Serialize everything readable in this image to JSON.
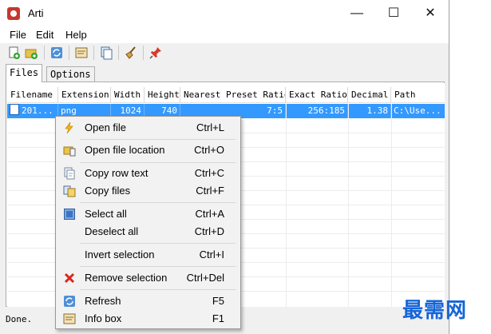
{
  "window": {
    "title": "Arti",
    "minimize_glyph": "—",
    "maximize_glyph": "☐",
    "close_glyph": "✕"
  },
  "menubar": {
    "items": [
      "File",
      "Edit",
      "Help"
    ]
  },
  "toolbar": {
    "icons": [
      "add-file-icon",
      "add-folder-icon",
      "refresh-icon",
      "info-box-icon",
      "copy-icon",
      "clear-icon",
      "pin-icon"
    ]
  },
  "tabs": [
    "Files",
    "Options"
  ],
  "table": {
    "columns": [
      "Filename",
      "Extension",
      "Width",
      "Height",
      "Nearest Preset Ratio",
      "Exact Ratio",
      "Decimal",
      "Path"
    ],
    "rows": [
      {
        "filename": "201...",
        "extension": "png",
        "width": "1024",
        "height": "740",
        "nearest": "7:5",
        "exact": "256:185",
        "decimal": "1.38",
        "path": "C:\\Use..."
      }
    ]
  },
  "status": {
    "text": "Done."
  },
  "context_menu": {
    "items": [
      {
        "label": "Open file",
        "shortcut": "Ctrl+L",
        "icon": "lightning-icon"
      },
      {
        "label": "Open file location",
        "shortcut": "Ctrl+O",
        "icon": "folder-icon"
      },
      {
        "label": "Copy row text",
        "shortcut": "Ctrl+C",
        "icon": "copy-text-icon"
      },
      {
        "label": "Copy files",
        "shortcut": "Ctrl+F",
        "icon": "copy-files-icon"
      },
      {
        "label": "Select all",
        "shortcut": "Ctrl+A",
        "icon": "select-all-icon"
      },
      {
        "label": "Deselect all",
        "shortcut": "Ctrl+D",
        "icon": ""
      },
      {
        "label": "Invert selection",
        "shortcut": "Ctrl+I",
        "icon": ""
      },
      {
        "label": "Remove selection",
        "shortcut": "Ctrl+Del",
        "icon": "red-x-icon"
      },
      {
        "label": "Refresh",
        "shortcut": "F5",
        "icon": "refresh-icon"
      },
      {
        "label": "Info box",
        "shortcut": "F1",
        "icon": "info-box-icon"
      }
    ]
  },
  "watermark": {
    "text": "最需网"
  },
  "colors": {
    "selection": "#3399ff",
    "app_icon": "#c8372d",
    "watermark": "#1565d8"
  }
}
